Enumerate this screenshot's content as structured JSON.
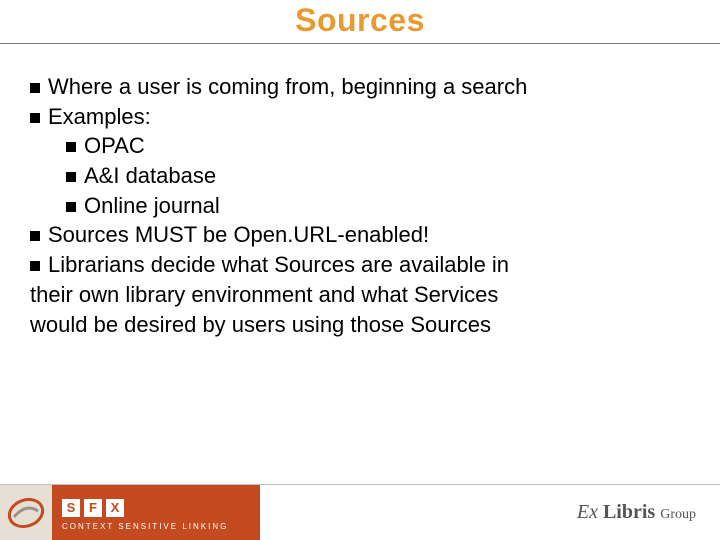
{
  "title": "Sources",
  "bullets": {
    "b1": "Where a user is coming from, beginning a search",
    "b2": "Examples:",
    "b2a": "OPAC",
    "b2b": "A&I database",
    "b2c": "Online journal",
    "b3": "Sources MUST be Open.URL-enabled!",
    "b4": "Librarians decide what Sources are available in",
    "b4_cont1": "their own library environment and what Services",
    "b4_cont2": "would be desired by users using those Sources"
  },
  "footer": {
    "sfx_s": "S",
    "sfx_f": "F",
    "sfx_x": "X",
    "tagline": "CONTEXT SENSITIVE LINKING",
    "brand_ex": "Ex",
    "brand_libris": " Libris ",
    "brand_group": "Group"
  }
}
